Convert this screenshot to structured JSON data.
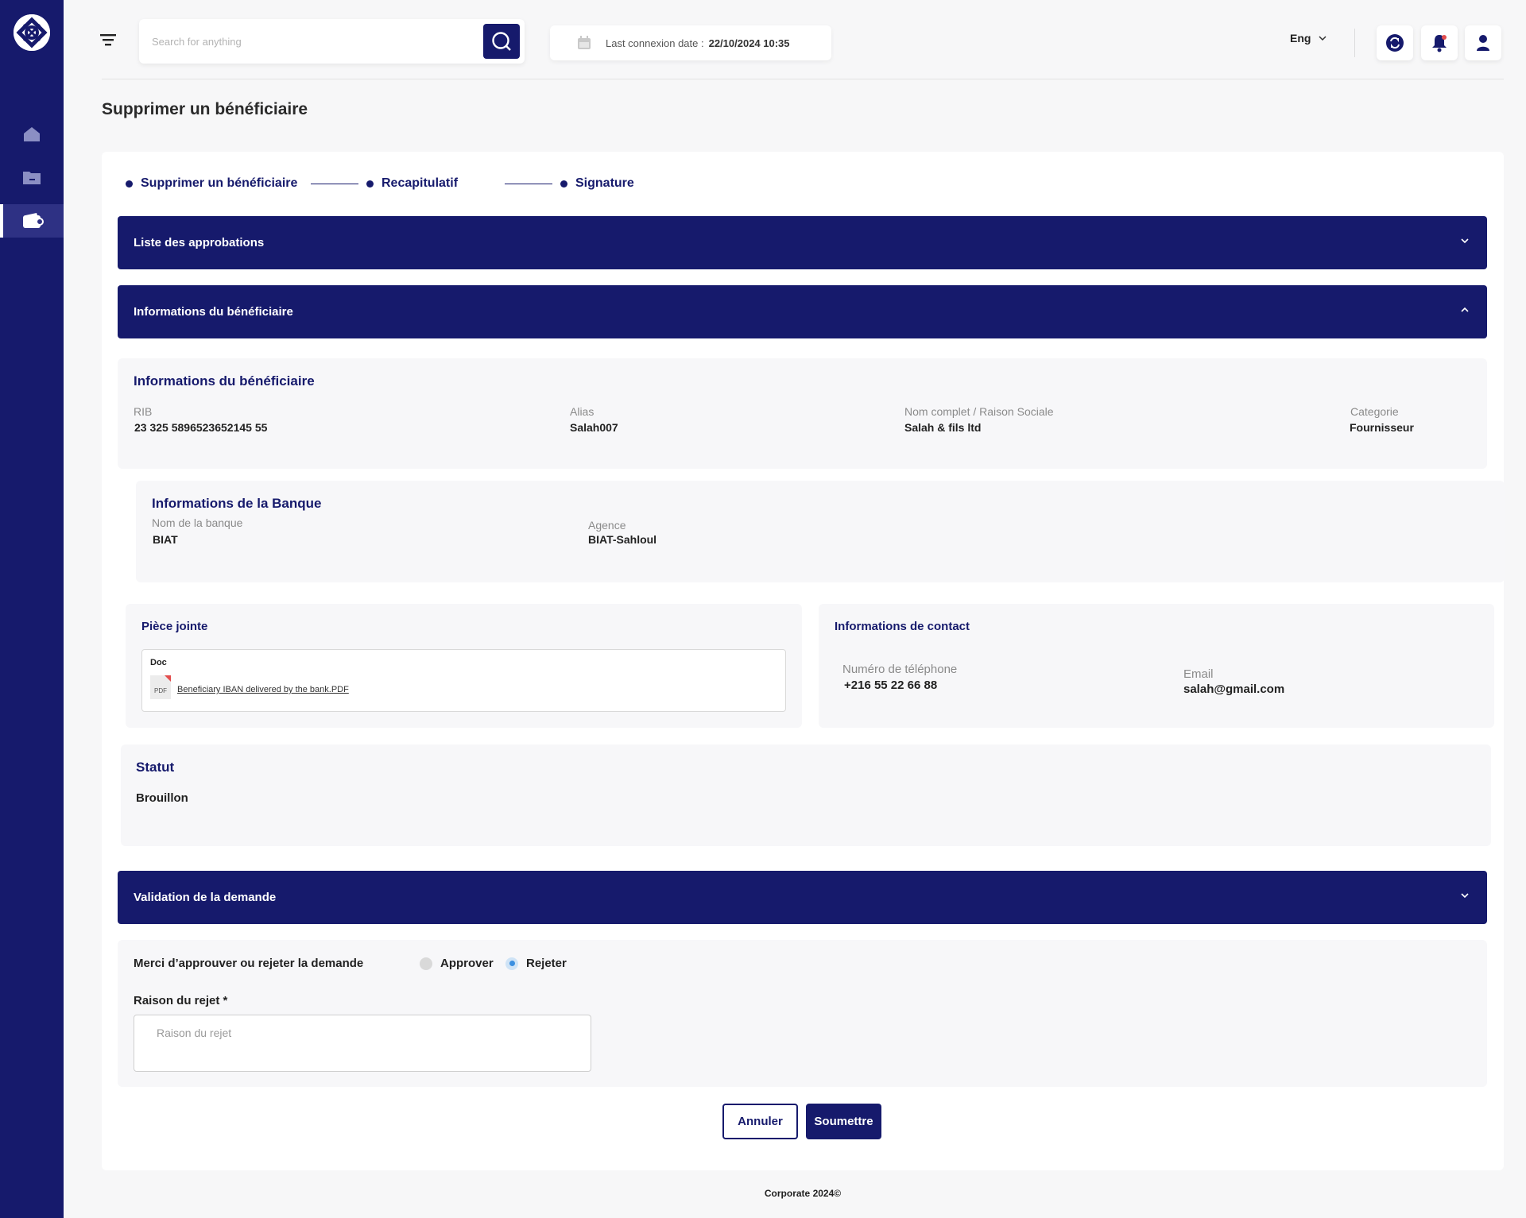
{
  "header": {
    "search_placeholder": "Search for anything",
    "last_connexion_label": "Last connexion date :",
    "last_connexion_date": "22/10/2024 10:35",
    "language": "Eng"
  },
  "sidebar": {
    "items": [
      {
        "icon": "home-icon",
        "active": false
      },
      {
        "icon": "folder-icon",
        "active": false
      },
      {
        "icon": "wallet-icon",
        "active": true
      }
    ]
  },
  "page_title": "Supprimer un bénéficiaire",
  "steps": [
    "Supprimer un bénéficiaire",
    "Recapitulatif",
    "Signature"
  ],
  "accordions": {
    "approvals": "Liste des approbations",
    "beneficiary": "Informations du bénéficiaire",
    "validation": "Validation de la demande"
  },
  "beneficiary": {
    "title": "Informations du bénéficiaire",
    "rib_label": "RIB",
    "rib_value": "23 325 5896523652145 55",
    "alias_label": "Alias",
    "alias_value": "Salah007",
    "name_label": "Nom complet / Raison Sociale",
    "name_value": "Salah & fils ltd",
    "category_label": "Categorie",
    "category_value": "Fournisseur"
  },
  "bank": {
    "title": "Informations de la Banque",
    "bank_label": "Nom de la banque",
    "bank_value": "BIAT",
    "agency_label": "Agence",
    "agency_value": "BIAT-Sahloul"
  },
  "attachment": {
    "title": "Pièce jointe",
    "doc_label": "Doc",
    "file_type": "PDF",
    "file_name": "Beneficiary IBAN delivered by the bank.PDF"
  },
  "contact": {
    "title": "Informations de contact",
    "phone_label": "Numéro de téléphone",
    "phone_value": "+216 55 22 66 88",
    "email_label": "Email",
    "email_value": "salah@gmail.com"
  },
  "status": {
    "title": "Statut",
    "value": "Brouillon"
  },
  "validation": {
    "question": "Merci d’approuver ou rejeter la demande",
    "approve_label": "Approver",
    "reject_label": "Rejeter",
    "selected": "Rejeter",
    "reason_label": "Raison du rejet *",
    "reason_placeholder": "Raison du rejet",
    "reason_value": ""
  },
  "buttons": {
    "cancel": "Annuler",
    "submit": "Soumettre"
  },
  "footer": "Corporate 2024©",
  "colors": {
    "primary": "#161a6c",
    "background": "#f7f7f8",
    "radio_selected": "#3b8fe0",
    "notification_dot": "#e34d4d"
  }
}
